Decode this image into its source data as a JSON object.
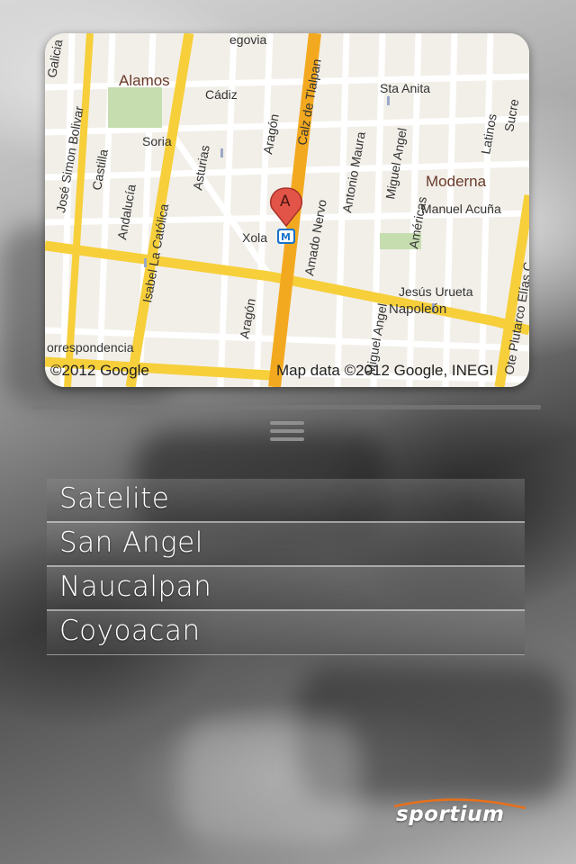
{
  "map": {
    "credit_left": "©2012 Google",
    "credit_right": "Map data ©2012 Google, INEGI",
    "marker_label": "A",
    "metro_label": "Xola",
    "metro_icon": "M",
    "streets": [
      "Alamos",
      "Cádiz",
      "Sta Anita",
      "Soria",
      "Aragón",
      "Calz de Tlalpan",
      "Antonio Maura",
      "Miguel Angel",
      "Moderna",
      "Américas",
      "Manuel Acuña",
      "Galicia",
      "José Simon Bolivar",
      "Castilla",
      "Andalucía",
      "Isabel La Católica",
      "Asturias",
      "Amado Nervo",
      "Napoleón",
      "Jesús Urueta",
      "Latinos",
      "Sucre",
      "Ote Plutarco Elías C",
      "Correspondencia",
      "Segovia"
    ]
  },
  "menu_icon": "hamburger-icon",
  "locations": [
    {
      "label": "Satelite"
    },
    {
      "label": "San Angel"
    },
    {
      "label": "Naucalpan"
    },
    {
      "label": "Coyoacan"
    }
  ],
  "brand": {
    "name": "sportium",
    "accent": "#e8701a"
  }
}
